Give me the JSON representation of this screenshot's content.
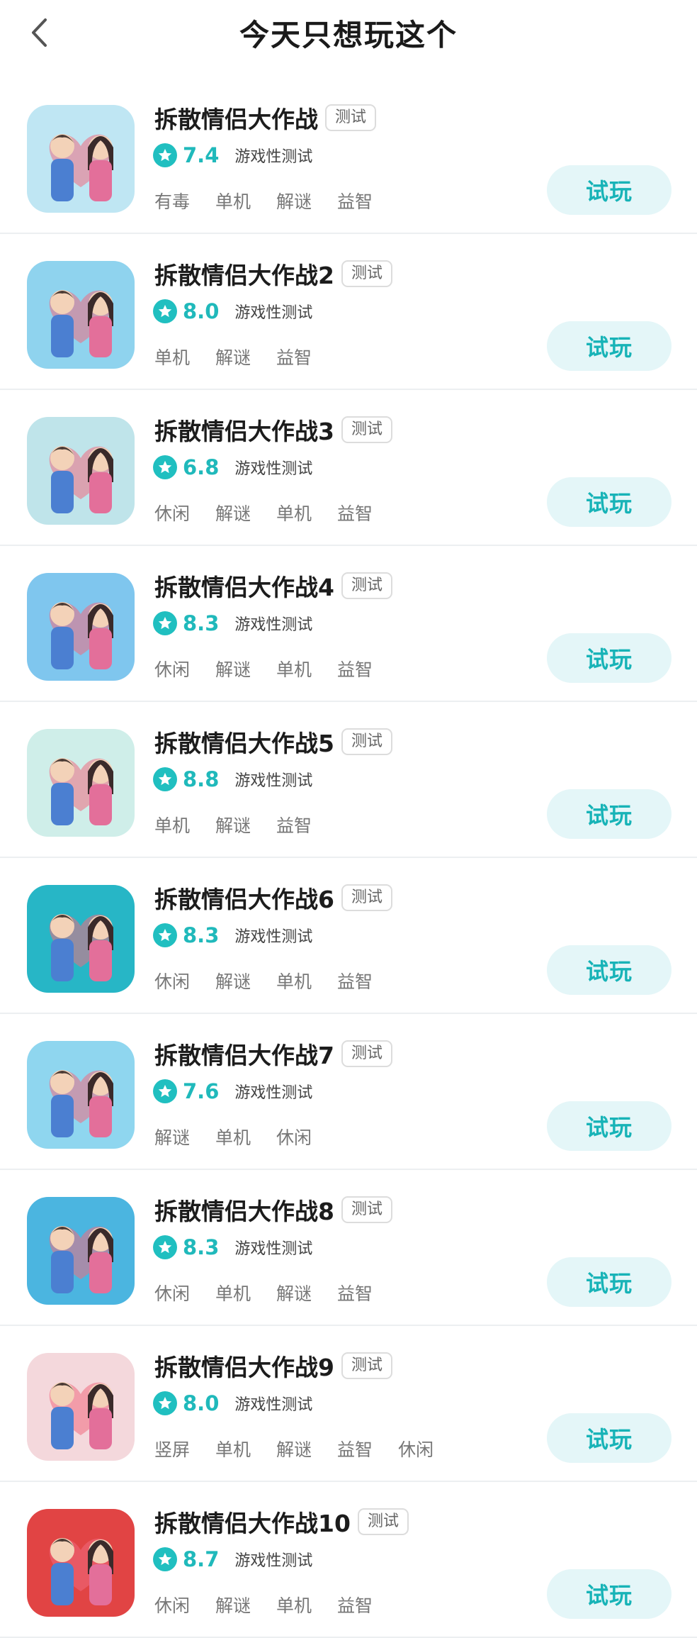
{
  "header": {
    "title": "今天只想玩这个"
  },
  "games": [
    {
      "name": "拆散情侣大作战",
      "badge": "测试",
      "score": "7.4",
      "genre": "游戏性测试",
      "tags": [
        "有毒",
        "单机",
        "解谜",
        "益智"
      ],
      "button": "试玩",
      "icon_color": "#bfe6f3"
    },
    {
      "name": "拆散情侣大作战2",
      "badge": "测试",
      "score": "8.0",
      "genre": "游戏性测试",
      "tags": [
        "单机",
        "解谜",
        "益智"
      ],
      "button": "试玩",
      "icon_color": "#8fd3ee"
    },
    {
      "name": "拆散情侣大作战3",
      "badge": "测试",
      "score": "6.8",
      "genre": "游戏性测试",
      "tags": [
        "休闲",
        "解谜",
        "单机",
        "益智"
      ],
      "button": "试玩",
      "icon_color": "#bfe4ea"
    },
    {
      "name": "拆散情侣大作战4",
      "badge": "测试",
      "score": "8.3",
      "genre": "游戏性测试",
      "tags": [
        "休闲",
        "解谜",
        "单机",
        "益智"
      ],
      "button": "试玩",
      "icon_color": "#7fc6ee"
    },
    {
      "name": "拆散情侣大作战5",
      "badge": "测试",
      "score": "8.8",
      "genre": "游戏性测试",
      "tags": [
        "单机",
        "解谜",
        "益智"
      ],
      "button": "试玩",
      "icon_color": "#cfeee9"
    },
    {
      "name": "拆散情侣大作战6",
      "badge": "测试",
      "score": "8.3",
      "genre": "游戏性测试",
      "tags": [
        "休闲",
        "解谜",
        "单机",
        "益智"
      ],
      "button": "试玩",
      "icon_color": "#27b6c6"
    },
    {
      "name": "拆散情侣大作战7",
      "badge": "测试",
      "score": "7.6",
      "genre": "游戏性测试",
      "tags": [
        "解谜",
        "单机",
        "休闲"
      ],
      "button": "试玩",
      "icon_color": "#8fd6ef"
    },
    {
      "name": "拆散情侣大作战8",
      "badge": "测试",
      "score": "8.3",
      "genre": "游戏性测试",
      "tags": [
        "休闲",
        "单机",
        "解谜",
        "益智"
      ],
      "button": "试玩",
      "icon_color": "#4bb5e0"
    },
    {
      "name": "拆散情侣大作战9",
      "badge": "测试",
      "score": "8.0",
      "genre": "游戏性测试",
      "tags": [
        "竖屏",
        "单机",
        "解谜",
        "益智",
        "休闲"
      ],
      "button": "试玩",
      "icon_color": "#f4d8dc"
    },
    {
      "name": "拆散情侣大作战10",
      "badge": "测试",
      "score": "8.7",
      "genre": "游戏性测试",
      "tags": [
        "休闲",
        "解谜",
        "单机",
        "益智"
      ],
      "button": "试玩",
      "icon_color": "#e14444"
    }
  ],
  "accent": "#20bfc0",
  "icons": {
    "back": "chevron-left-icon",
    "rating": "star-icon"
  }
}
